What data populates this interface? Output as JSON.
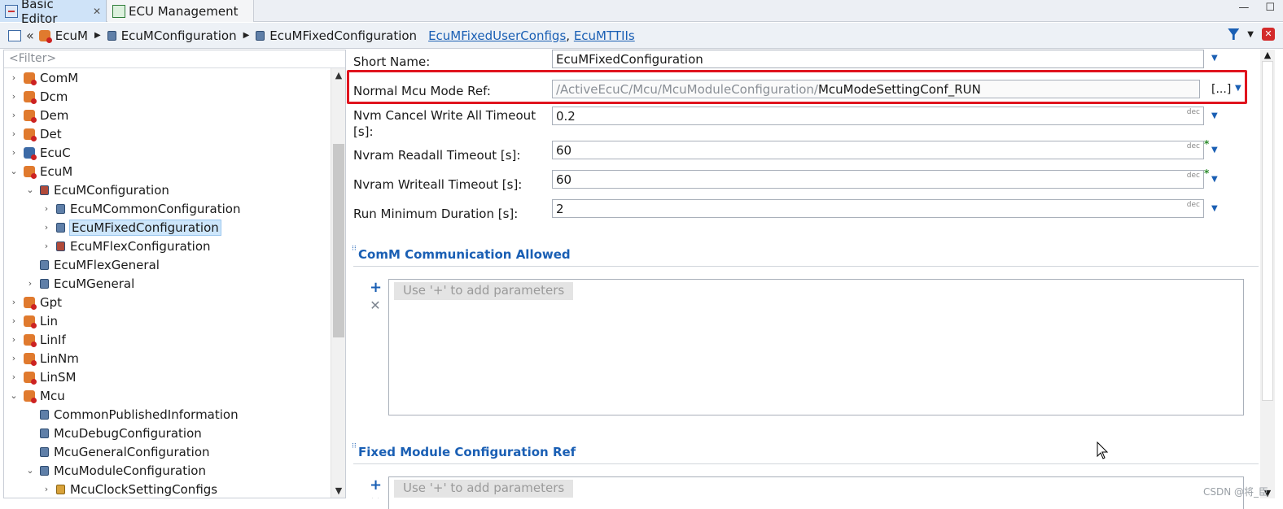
{
  "tabs": {
    "basic_editor": "Basic Editor",
    "basic_editor_close": "✕",
    "ecu_management": "ECU Management"
  },
  "window_buttons": {
    "minimize": "—",
    "maximize": "☐"
  },
  "breadcrumb": {
    "back": "«",
    "items": [
      "EcuM",
      "EcuMConfiguration",
      "EcuMFixedConfiguration"
    ],
    "links": [
      "EcuMFixedUserConfigs",
      "EcuMTTIIs"
    ],
    "link_sep": ","
  },
  "tree": {
    "filter_placeholder": "<Filter>",
    "nodes": [
      {
        "label": "ComM"
      },
      {
        "label": "Dcm"
      },
      {
        "label": "Dem"
      },
      {
        "label": "Det"
      },
      {
        "label": "EcuC"
      },
      {
        "label": "EcuM"
      },
      {
        "label": "EcuMConfiguration"
      },
      {
        "label": "EcuMCommonConfiguration"
      },
      {
        "label": "EcuMFixedConfiguration"
      },
      {
        "label": "EcuMFlexConfiguration"
      },
      {
        "label": "EcuMFlexGeneral"
      },
      {
        "label": "EcuMGeneral"
      },
      {
        "label": "Gpt"
      },
      {
        "label": "Lin"
      },
      {
        "label": "LinIf"
      },
      {
        "label": "LinNm"
      },
      {
        "label": "LinSM"
      },
      {
        "label": "Mcu"
      },
      {
        "label": "CommonPublishedInformation"
      },
      {
        "label": "McuDebugConfiguration"
      },
      {
        "label": "McuGeneralConfiguration"
      },
      {
        "label": "McuModuleConfiguration"
      },
      {
        "label": "McuClockSettingConfigs"
      }
    ]
  },
  "form": {
    "short_name": {
      "label": "Short Name:",
      "value": "EcuMFixedConfiguration"
    },
    "normal_mcu_mode_ref": {
      "label": "Normal Mcu Mode Ref:",
      "path_prefix": "/ActiveEcuC/Mcu/McuModuleConfiguration/",
      "path_target": "McuModeSettingConf_RUN",
      "browse": "[...]"
    },
    "nvm_cancel_write_all_timeout": {
      "label_line1": "Nvm Cancel Write All Timeout",
      "label_line2": "[s]:",
      "value": "0.2",
      "format": "dec"
    },
    "nvram_readall_timeout": {
      "label": "Nvram Readall Timeout [s]:",
      "value": "60",
      "format": "dec",
      "modified": "*"
    },
    "nvram_writeall_timeout": {
      "label": "Nvram Writeall Timeout [s]:",
      "value": "60",
      "format": "dec",
      "modified": "*"
    },
    "run_minimum_duration": {
      "label": "Run Minimum Duration [s]:",
      "value": "2",
      "format": "dec"
    }
  },
  "sections": {
    "comm_allowed": {
      "title": "ComM Communication Allowed",
      "hint": "Use '+' to add parameters"
    },
    "fixed_module_ref": {
      "title": "Fixed Module Configuration Ref",
      "hint": "Use '+' to add parameters"
    }
  },
  "watermark": "CSDN @将_臣",
  "colors": {
    "highlight": "#e0141e",
    "link": "#1a5fb4",
    "selection": "#cde6fb"
  }
}
